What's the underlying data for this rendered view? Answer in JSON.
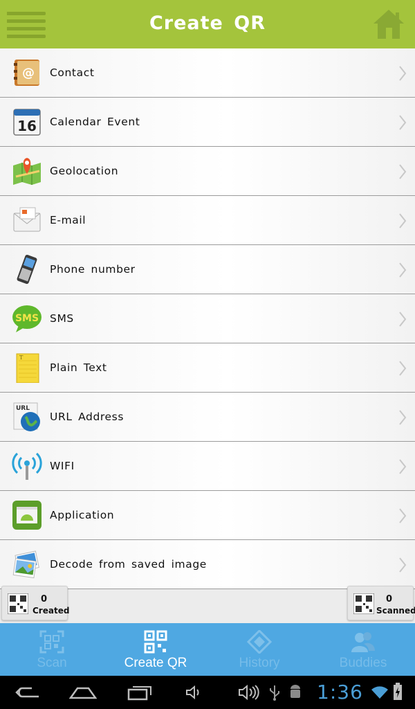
{
  "header": {
    "title": "Create QR",
    "menu_icon": "menu-icon",
    "home_icon": "home-icon"
  },
  "items": [
    {
      "label": "Contact",
      "icon": "contact-book-icon"
    },
    {
      "label": "Calendar Event",
      "icon": "calendar-icon",
      "icon_text": "16"
    },
    {
      "label": "Geolocation",
      "icon": "map-pin-icon"
    },
    {
      "label": "E-mail",
      "icon": "envelope-icon"
    },
    {
      "label": "Phone number",
      "icon": "mobile-phone-icon"
    },
    {
      "label": "SMS",
      "icon": "sms-bubble-icon",
      "icon_text": "SMS"
    },
    {
      "label": "Plain Text",
      "icon": "notepad-icon"
    },
    {
      "label": "URL Address",
      "icon": "globe-icon",
      "icon_text": "URL"
    },
    {
      "label": "WIFI",
      "icon": "wifi-icon"
    },
    {
      "label": "Application",
      "icon": "android-app-icon"
    },
    {
      "label": "Decode from saved image",
      "icon": "photos-icon"
    }
  ],
  "counters": {
    "created": {
      "value": "0",
      "label": "Created"
    },
    "scanned": {
      "value": "0",
      "label": "Scanned"
    }
  },
  "tabs": [
    {
      "label": "Scan",
      "icon": "scan-icon",
      "active": false
    },
    {
      "label": "Create QR",
      "icon": "qr-code-icon",
      "active": true
    },
    {
      "label": "History",
      "icon": "history-icon",
      "active": false
    },
    {
      "label": "Buddies",
      "icon": "buddies-icon",
      "active": false
    }
  ],
  "system_bar": {
    "time": "1:36"
  },
  "colors": {
    "header": "#a4c43c",
    "tabbar": "#4fa8e2",
    "active_tab_text": "#ffffff",
    "clock": "#4a9ed6"
  }
}
